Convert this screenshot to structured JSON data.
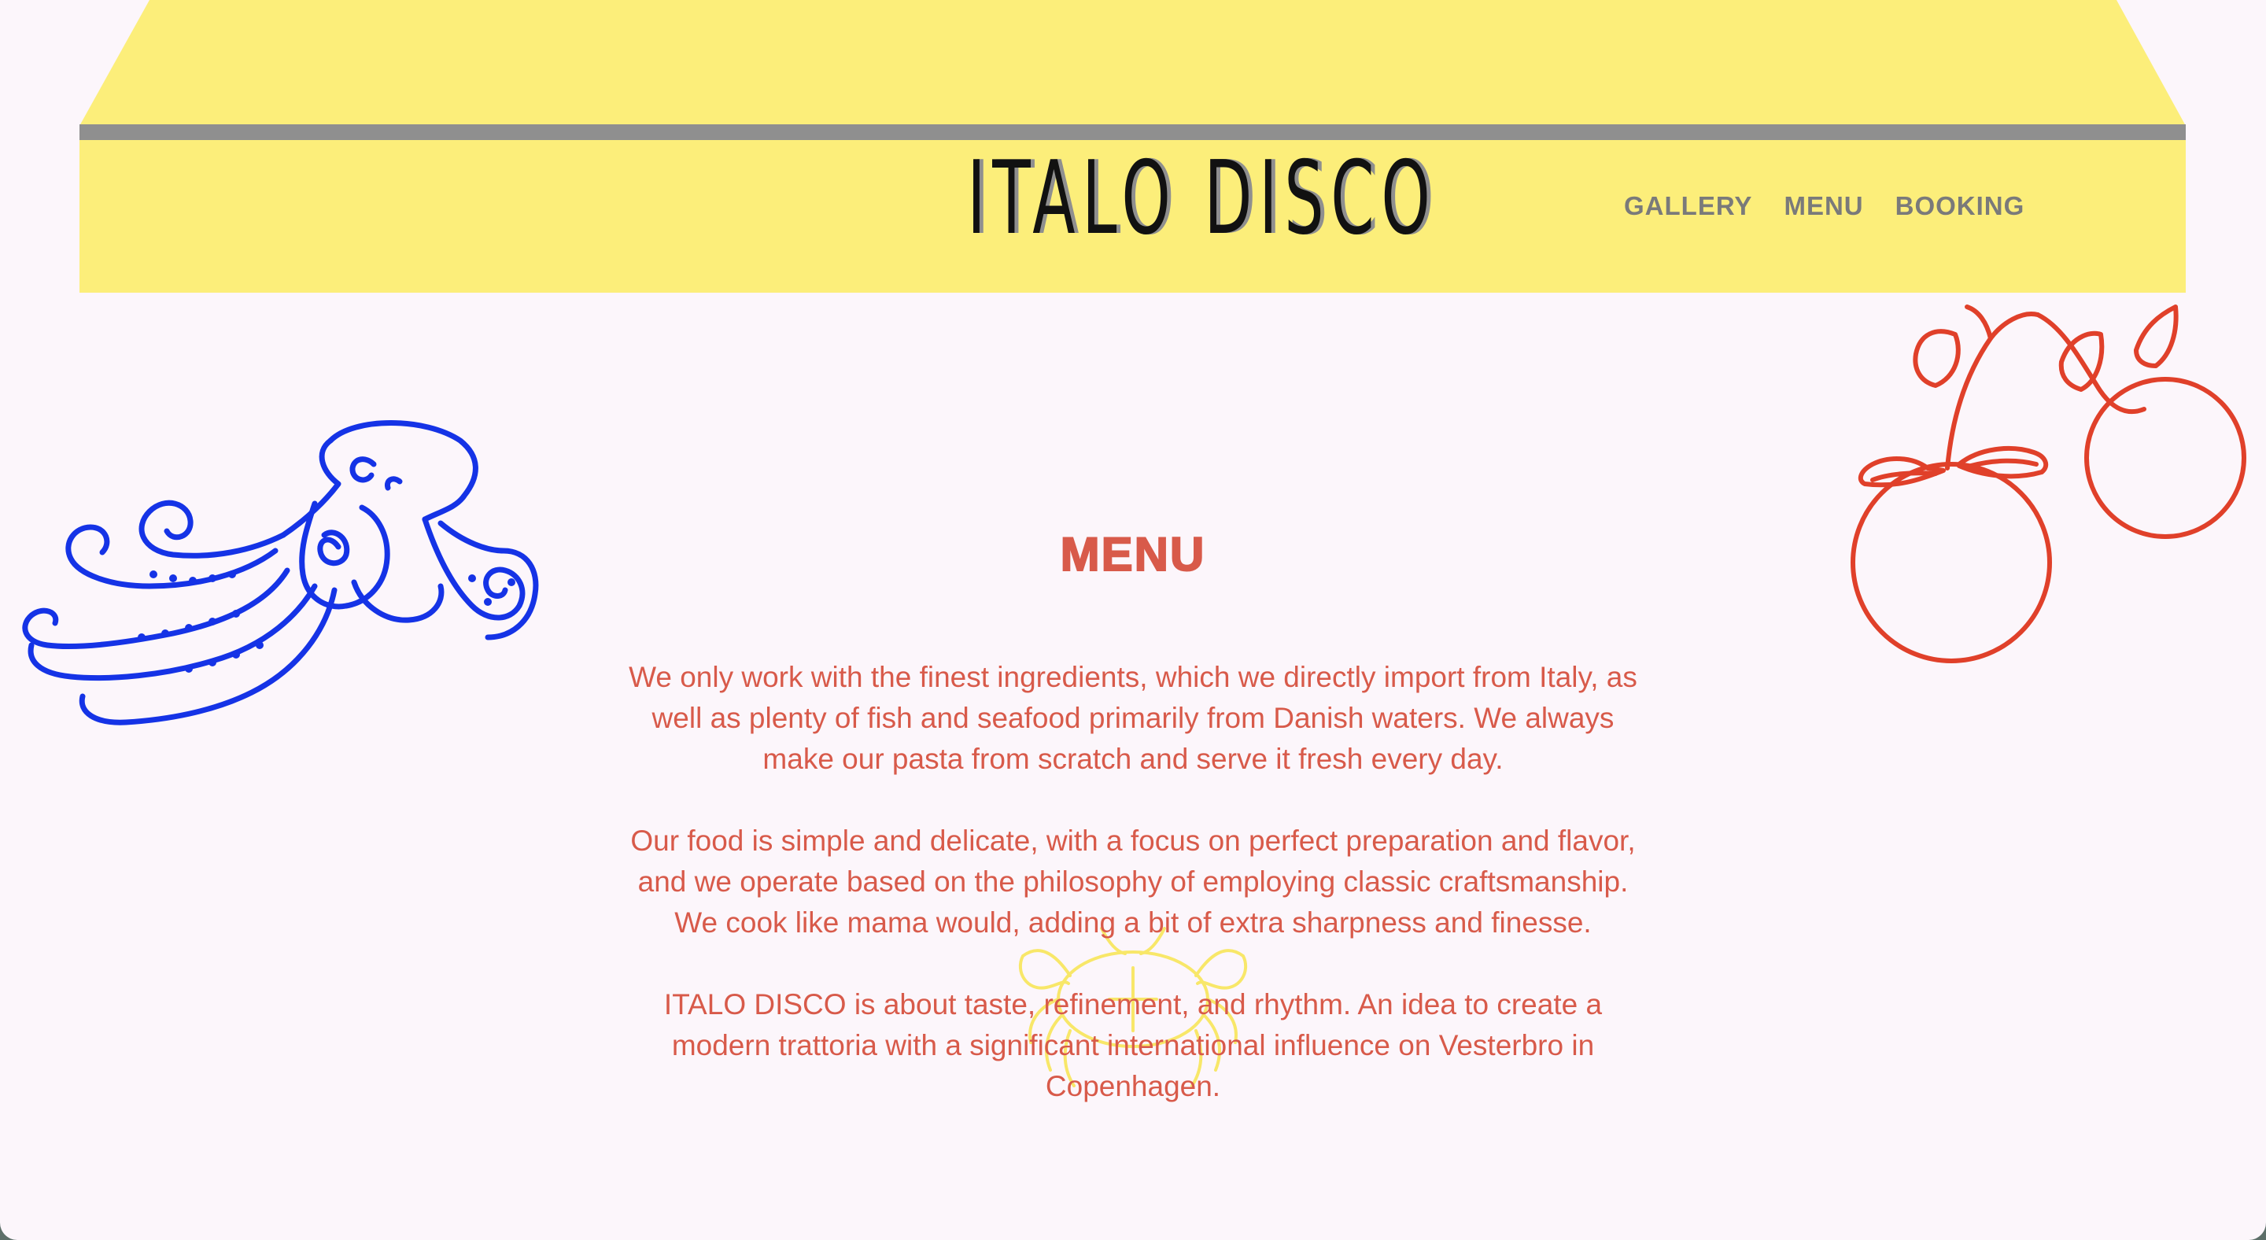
{
  "site": {
    "brand": "ITALO DISCO"
  },
  "nav": {
    "items": [
      {
        "label": "GALLERY"
      },
      {
        "label": "MENU"
      },
      {
        "label": "BOOKING"
      }
    ]
  },
  "main": {
    "title": "MENU",
    "paragraphs": [
      "We only work with the finest ingredients, which we directly import from Italy, as well as plenty of fish and seafood primarily from Danish waters. We always make our pasta from scratch and serve it fresh every day.",
      "Our food is simple and delicate, with a focus on perfect preparation and flavor, and we operate based on the philosophy of employing classic craftsmanship. We cook like mama would, adding a bit of extra sharpness and finesse.",
      "ITALO DISCO is about taste, refinement, and rhythm. An idea to create a modern trattoria with a significant international influence on Vesterbro in Copenhagen."
    ]
  },
  "illustrations": {
    "left": "octopus-illustration",
    "right": "oranges-illustration",
    "center": "crab-illustration"
  },
  "colors": {
    "page_background": "#fcf6fb",
    "awning_yellow": "#fcee7a",
    "awning_stripe": "#8f8f8f",
    "text_accent": "#d85a4a",
    "nav_text": "#7a7a7a",
    "octopus_blue": "#1533e6",
    "orange_red": "#e0402a",
    "crab_yellow": "#f8e65a"
  }
}
